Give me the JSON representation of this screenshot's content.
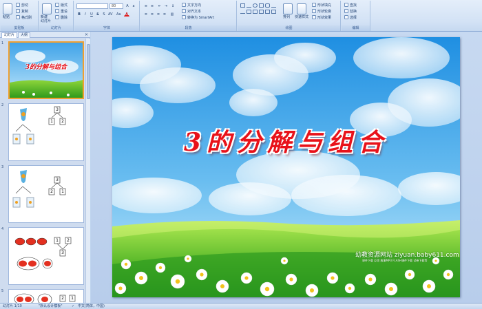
{
  "ribbon": {
    "clipboard": {
      "paste": "粘贴",
      "cut": "剪切",
      "copy": "复制",
      "format_painter": "格式刷",
      "label": "剪贴板"
    },
    "slides": {
      "new_slide": "新建\n幻灯片",
      "layout": "版式",
      "reset": "重设",
      "delete": "删除",
      "label": "幻灯片"
    },
    "font": {
      "font_name": "",
      "font_size": "80",
      "label": "字体"
    },
    "paragraph": {
      "text_direction": "文字方向",
      "align_text": "对齐文本",
      "smartart": "转换为 SmartArt",
      "label": "段落"
    },
    "drawing": {
      "arrange": "排列",
      "quick_styles": "快速样式",
      "shape_fill": "形状填充",
      "shape_outline": "形状轮廓",
      "shape_effects": "形状效果",
      "label": "绘图"
    },
    "editing": {
      "find": "查找",
      "replace": "替换",
      "select": "选择",
      "label": "编辑"
    }
  },
  "pane": {
    "tab_slides": "幻灯片",
    "tab_outline": "大纲",
    "close": "×",
    "thumbs": [
      {
        "num": "1",
        "title": "3的分解与组合"
      },
      {
        "num": "2",
        "top": "3",
        "left": "1",
        "right": "2"
      },
      {
        "num": "3",
        "top": "3",
        "left": "2",
        "right": "1"
      },
      {
        "num": "4",
        "left": "1",
        "right": "2",
        "bottom": "3"
      },
      {
        "num": "5",
        "left": "2",
        "right": "1"
      }
    ]
  },
  "slide": {
    "title": "3的分解与组合",
    "watermark": "幼教资源网站 ziyuan.baby611.com",
    "watermark_sub": "课件下载  反思  故事MP3  FLASH课件下载  试卷下载等"
  },
  "status": {
    "slide_info": "幻灯片 1/10",
    "theme": "\"默认设计模板\"",
    "language": "中文(简体，中国)"
  }
}
